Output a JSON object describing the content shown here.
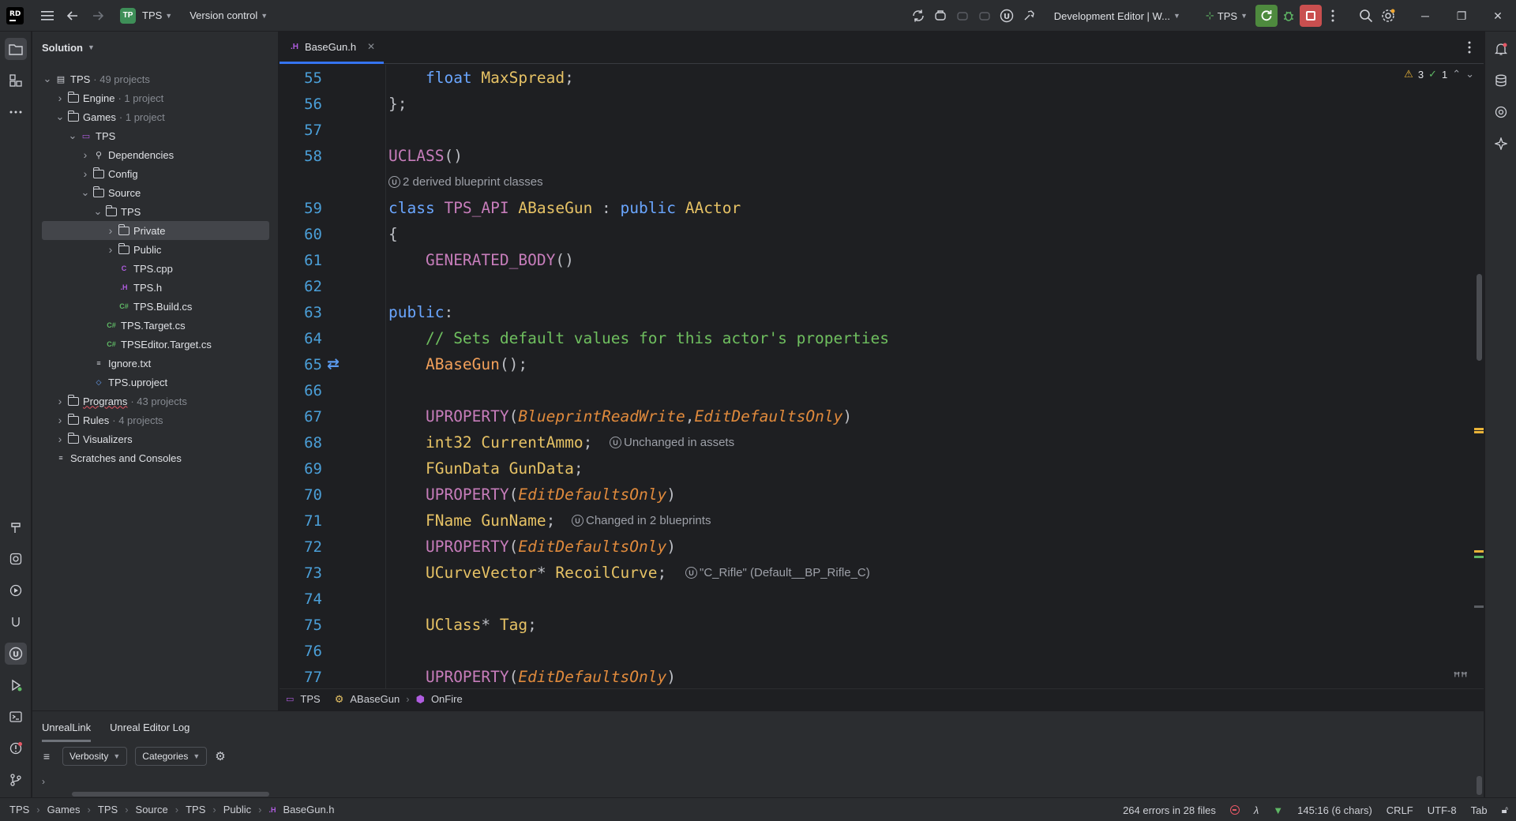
{
  "toolbar": {
    "logo_text": "RD",
    "project_badge": "TP",
    "project_name": "TPS",
    "version_control": "Version control",
    "run_config": "Development Editor | W...",
    "target": "TPS"
  },
  "project_panel": {
    "title": "Solution",
    "tree": [
      {
        "label": "TPS",
        "muted": "· 49 projects",
        "depth": 0,
        "twisty": "open",
        "icon": "solution-icon"
      },
      {
        "label": "Engine",
        "muted": "· 1 project",
        "depth": 1,
        "twisty": "closed",
        "icon": "folder-icon"
      },
      {
        "label": "Games",
        "muted": "· 1 project",
        "depth": 1,
        "twisty": "open",
        "icon": "folder-icon"
      },
      {
        "label": "TPS",
        "muted": "",
        "depth": 2,
        "twisty": "open",
        "icon": "project-icon"
      },
      {
        "label": "Dependencies",
        "muted": "",
        "depth": 3,
        "twisty": "closed",
        "icon": "dependencies-icon"
      },
      {
        "label": "Config",
        "muted": "",
        "depth": 3,
        "twisty": "closed",
        "icon": "folder-icon"
      },
      {
        "label": "Source",
        "muted": "",
        "depth": 3,
        "twisty": "open",
        "icon": "folder-icon"
      },
      {
        "label": "TPS",
        "muted": "",
        "depth": 4,
        "twisty": "open",
        "icon": "folder-icon"
      },
      {
        "label": "Private",
        "muted": "",
        "depth": 5,
        "twisty": "closed",
        "icon": "folder-icon",
        "selected": true
      },
      {
        "label": "Public",
        "muted": "",
        "depth": 5,
        "twisty": "closed",
        "icon": "folder-icon"
      },
      {
        "label": "TPS.cpp",
        "muted": "",
        "depth": 5,
        "twisty": "none",
        "icon": "cpp-file-icon"
      },
      {
        "label": "TPS.h",
        "muted": "",
        "depth": 5,
        "twisty": "none",
        "icon": "header-file-icon"
      },
      {
        "label": "TPS.Build.cs",
        "muted": "",
        "depth": 5,
        "twisty": "none",
        "icon": "csharp-file-icon"
      },
      {
        "label": "TPS.Target.cs",
        "muted": "",
        "depth": 4,
        "twisty": "none",
        "icon": "csharp-file-icon"
      },
      {
        "label": "TPSEditor.Target.cs",
        "muted": "",
        "depth": 4,
        "twisty": "none",
        "icon": "csharp-file-icon"
      },
      {
        "label": "Ignore.txt",
        "muted": "",
        "depth": 3,
        "twisty": "none",
        "icon": "text-file-icon"
      },
      {
        "label": "TPS.uproject",
        "muted": "",
        "depth": 3,
        "twisty": "none",
        "icon": "uproject-file-icon"
      },
      {
        "label": "Programs",
        "muted": "· 43 projects",
        "depth": 1,
        "twisty": "closed",
        "icon": "folder-icon"
      },
      {
        "label": "Rules",
        "muted": "· 4 projects",
        "depth": 1,
        "twisty": "closed",
        "icon": "folder-icon"
      },
      {
        "label": "Visualizers",
        "muted": "",
        "depth": 1,
        "twisty": "closed",
        "icon": "folder-icon"
      },
      {
        "label": "Scratches and Consoles",
        "muted": "",
        "depth": 0,
        "twisty": "none",
        "icon": "scratches-icon"
      }
    ]
  },
  "editor": {
    "tab_label": "BaseGun.h",
    "inspections": {
      "warnings": "3",
      "weak": "1"
    },
    "hints": {
      "derived_blueprints": "2 derived blueprint classes",
      "unchanged_assets": "Unchanged in assets",
      "changed_blueprints": "Changed in 2 blueprints",
      "rifle_value": "\"C_Rifle\" (Default__BP_Rifle_C)"
    },
    "line_numbers": [
      "55",
      "56",
      "57",
      "58",
      "59",
      "60",
      "61",
      "62",
      "63",
      "64",
      "65",
      "66",
      "67",
      "68",
      "69",
      "70",
      "71",
      "72",
      "73",
      "74",
      "75",
      "76",
      "77"
    ],
    "breadcrumb": [
      "TPS",
      "ABaseGun",
      "OnFire"
    ]
  },
  "bottom_panel": {
    "tabs": [
      "UnrealLink",
      "Unreal Editor Log"
    ],
    "verbosity": "Verbosity",
    "categories": "Categories"
  },
  "status_bar": {
    "path": [
      "TPS",
      "Games",
      "TPS",
      "Source",
      "TPS",
      "Public",
      "BaseGun.h"
    ],
    "errors": "264 errors in 28 files",
    "position": "145:16 (6 chars)",
    "line_ending": "CRLF",
    "encoding": "UTF-8",
    "indent": "Tab"
  }
}
